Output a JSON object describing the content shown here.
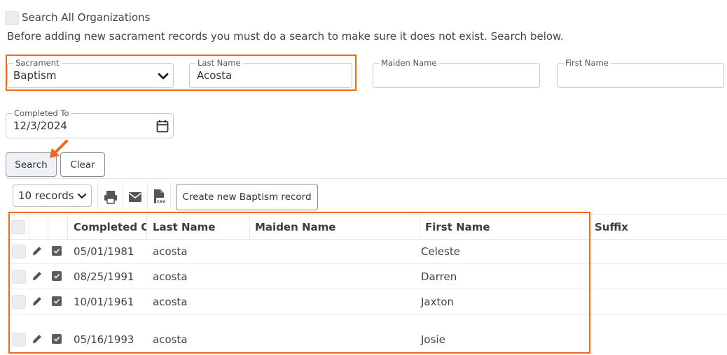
{
  "search_all": {
    "label": "Search All Organizations"
  },
  "instruction": "Before adding new sacrament records you must do a search to make sure it does not exist. Search below.",
  "form": {
    "sacrament": {
      "label": "Sacrament",
      "value": "Baptism"
    },
    "last_name": {
      "label": "Last Name",
      "value": "Acosta"
    },
    "maiden_name": {
      "label": "Maiden Name",
      "value": ""
    },
    "first_name": {
      "label": "First Name",
      "value": ""
    },
    "completed_to": {
      "label": "Completed To",
      "value": "12/3/2024"
    }
  },
  "buttons": {
    "search": "Search",
    "clear": "Clear"
  },
  "toolbar": {
    "records_select": "10 records",
    "export_icons": [
      "print-icon",
      "email-icon",
      "csv-icon"
    ],
    "create_button": "Create new Baptism record"
  },
  "table": {
    "columns": [
      "Completed On",
      "Last Name",
      "Maiden Name",
      "First Name",
      "Suffix"
    ],
    "columns_visible": [
      "Completed Or",
      "Last Name",
      "Maiden Name",
      "First Name",
      "Suffix"
    ],
    "rows": [
      {
        "completed": "05/01/1981",
        "last": "acosta",
        "maiden": "",
        "first": "Celeste",
        "suffix": ""
      },
      {
        "completed": "08/25/1991",
        "last": "acosta",
        "maiden": "",
        "first": "Darren",
        "suffix": ""
      },
      {
        "completed": "10/01/1961",
        "last": "acosta",
        "maiden": "",
        "first": "Jaxton",
        "suffix": ""
      },
      {
        "completed": "05/16/1993",
        "last": "acosta",
        "maiden": "",
        "first": "Josie",
        "suffix": ""
      }
    ]
  },
  "colors": {
    "accent": "#ee6a1f",
    "checkbox_dark": "#5d5d5d"
  }
}
